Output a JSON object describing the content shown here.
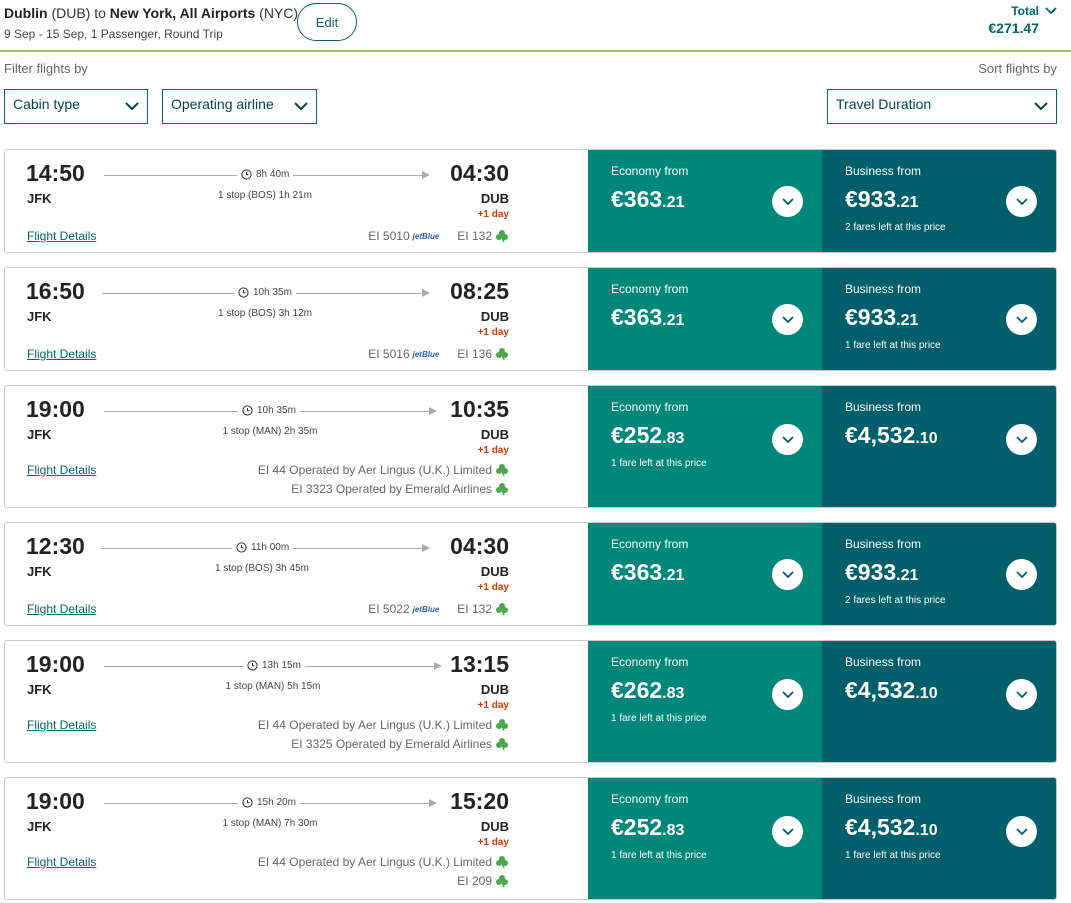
{
  "header": {
    "origin_city": "Dublin",
    "origin_code": "(DUB)",
    "to_word": "to",
    "dest_city": "New York, All Airports",
    "dest_code": "(NYC)",
    "trip_info": "9 Sep - 15 Sep, 1 Passenger, Round Trip",
    "edit_label": "Edit",
    "total_label": "Total",
    "total_amount": "€271.47"
  },
  "filters": {
    "filter_label": "Filter flights by",
    "sort_label": "Sort flights by",
    "cabin_label": "Cabin type",
    "airline_label": "Operating airline",
    "sort_value": "Travel Duration"
  },
  "flights": [
    {
      "dep_time": "14:50",
      "dep_code": "JFK",
      "arr_time": "04:30",
      "arr_code": "DUB",
      "plus_day": "+1 day",
      "duration": "8h 40m",
      "stops": "1 stop (BOS) 1h 21m",
      "details": "Flight Details",
      "op1_code": "EI 5010",
      "op1_carrier": "jetBlue",
      "op2_code": "EI 132",
      "eco_label": "Economy from",
      "eco_main": "€363",
      "eco_cents": ".21",
      "eco_note": "",
      "bus_label": "Business from",
      "bus_main": "€933",
      "bus_cents": ".21",
      "bus_note": "2 fares left at this price"
    },
    {
      "dep_time": "16:50",
      "dep_code": "JFK",
      "arr_time": "08:25",
      "arr_code": "DUB",
      "plus_day": "+1 day",
      "duration": "10h 35m",
      "stops": "1 stop (BOS) 3h 12m",
      "details": "Flight Details",
      "op1_code": "EI 5016",
      "op1_carrier": "jetBlue",
      "op2_code": "EI 136",
      "eco_label": "Economy from",
      "eco_main": "€363",
      "eco_cents": ".21",
      "eco_note": "",
      "bus_label": "Business from",
      "bus_main": "€933",
      "bus_cents": ".21",
      "bus_note": "1 fare left at this price"
    },
    {
      "dep_time": "19:00",
      "dep_code": "JFK",
      "arr_time": "10:35",
      "arr_code": "DUB",
      "plus_day": "+1 day",
      "duration": "10h 35m",
      "stops": "1 stop (MAN) 2h 35m",
      "details": "Flight Details",
      "op_line1": "EI 44 Operated by Aer Lingus (U.K.) Limited",
      "op_line2": "EI 3323 Operated by Emerald Airlines",
      "eco_label": "Economy from",
      "eco_main": "€252",
      "eco_cents": ".83",
      "eco_note": "1 fare left at this price",
      "bus_label": "Business from",
      "bus_main": "€4,532",
      "bus_cents": ".10",
      "bus_note": ""
    },
    {
      "dep_time": "12:30",
      "dep_code": "JFK",
      "arr_time": "04:30",
      "arr_code": "DUB",
      "plus_day": "+1 day",
      "duration": "11h 00m",
      "stops": "1 stop (BOS) 3h 45m",
      "details": "Flight Details",
      "op1_code": "EI 5022",
      "op1_carrier": "jetBlue",
      "op2_code": "EI 132",
      "eco_label": "Economy from",
      "eco_main": "€363",
      "eco_cents": ".21",
      "eco_note": "",
      "bus_label": "Business from",
      "bus_main": "€933",
      "bus_cents": ".21",
      "bus_note": "2 fares left at this price"
    },
    {
      "dep_time": "19:00",
      "dep_code": "JFK",
      "arr_time": "13:15",
      "arr_code": "DUB",
      "plus_day": "+1 day",
      "duration": "13h 15m",
      "stops": "1 stop (MAN) 5h 15m",
      "details": "Flight Details",
      "op_line1": "EI 44 Operated by Aer Lingus (U.K.) Limited",
      "op_line2": "EI 3325 Operated by Emerald Airlines",
      "eco_label": "Economy from",
      "eco_main": "€262",
      "eco_cents": ".83",
      "eco_note": "1 fare left at this price",
      "bus_label": "Business from",
      "bus_main": "€4,532",
      "bus_cents": ".10",
      "bus_note": ""
    },
    {
      "dep_time": "19:00",
      "dep_code": "JFK",
      "arr_time": "15:20",
      "arr_code": "DUB",
      "plus_day": "+1 day",
      "duration": "15h 20m",
      "stops": "1 stop (MAN) 7h 30m",
      "details": "Flight Details",
      "op_line1": "EI 44 Operated by Aer Lingus (U.K.) Limited",
      "op_line2": "EI 209",
      "eco_label": "Economy from",
      "eco_main": "€252",
      "eco_cents": ".83",
      "eco_note": "1 fare left at this price",
      "bus_label": "Business from",
      "bus_main": "€4,532",
      "bus_cents": ".10",
      "bus_note": "1 fare left at this price"
    }
  ],
  "icons": {
    "chevron": "chevron-down-icon",
    "clock": "clock-icon",
    "shamrock": "shamrock-icon"
  },
  "colors": {
    "brand_teal": "#00646a",
    "economy_bg": "#00877a",
    "business_bg": "#005f6b",
    "plus_day": "#d03a00",
    "header_rule": "#9cc46b"
  }
}
